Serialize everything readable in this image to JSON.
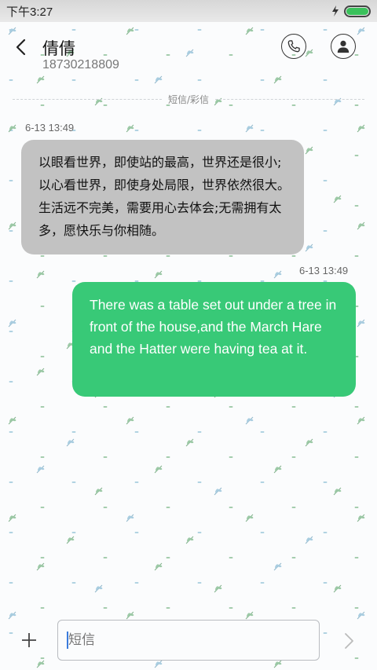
{
  "status_bar": {
    "time": "下午3:27",
    "battery_level": 1.0,
    "charging_icon": "bolt-icon",
    "battery_color": "#3ac15b"
  },
  "header": {
    "back_icon": "back-arrow-icon",
    "contact_name": "倩倩",
    "contact_number": "18730218809",
    "call_icon": "phone-icon",
    "profile_icon": "person-icon"
  },
  "divider_label": "短信/彩信",
  "messages": [
    {
      "direction": "incoming",
      "time": "6-13 13:49",
      "text": "以眼看世界，即使站的最高，世界还是很小;以心看世界，即使身处局限，世界依然很大。生活远不完美，需要用心去体会;无需拥有太多，愿快乐与你相随。",
      "bubble_color": "#c2c2c2"
    },
    {
      "direction": "outgoing",
      "time": "6-13 13:49",
      "text": "There was a table set out under a tree in front of the house,and the March Hare and the Hatter were having tea at it.",
      "bubble_color": "#38c977"
    }
  ],
  "composer": {
    "add_icon": "plus-icon",
    "placeholder": "短信",
    "value": "",
    "send_icon": "chevron-right-icon"
  }
}
